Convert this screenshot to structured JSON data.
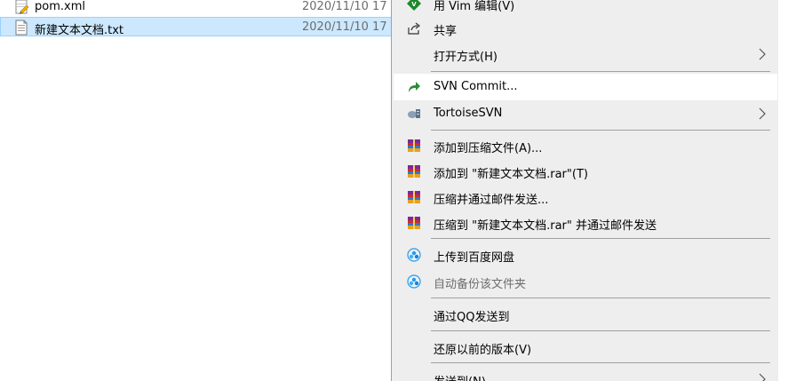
{
  "files": [
    {
      "name": "pom.xml",
      "date": "2020/11/10 17",
      "icon": "xml-file-icon",
      "selected": false
    },
    {
      "name": "新建文本文档.txt",
      "date": "2020/11/10 17",
      "icon": "text-file-icon",
      "selected": true
    }
  ],
  "menu": {
    "vim_edit": "用 Vim 编辑(V)",
    "share": "共享",
    "open_with": "打开方式(H)",
    "svn_commit": "SVN Commit...",
    "tortoise_svn": "TortoiseSVN",
    "add_to_archive": "添加到压缩文件(A)...",
    "add_to_rar": "添加到 \"新建文本文档.rar\"(T)",
    "compress_email": "压缩并通过邮件发送...",
    "compress_rar_email": "压缩到 \"新建文本文档.rar\" 并通过邮件发送",
    "upload_baidu": "上传到百度网盘",
    "auto_backup": "自动备份该文件夹",
    "send_via_qq": "通过QQ发送到",
    "restore_versions": "还原以前的版本(V)",
    "send_to": "发送到(N)"
  },
  "colors": {
    "menu_background": "#eeeeee",
    "highlight": "#ffffff",
    "selection": "#cce8ff",
    "selection_border": "#99d1ff",
    "separator": "#a0a0a0",
    "svn_green": "#2e8b3a",
    "baidu_blue": "#2b9ae8"
  }
}
